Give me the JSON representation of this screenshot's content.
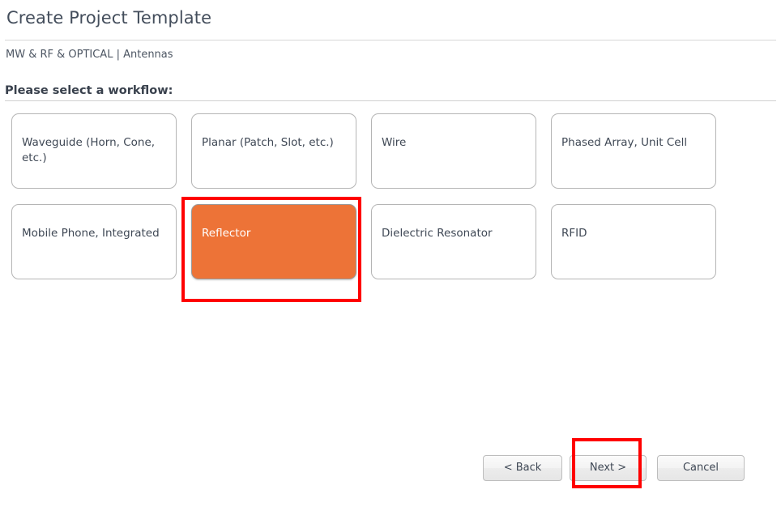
{
  "header": {
    "title": "Create Project Template",
    "breadcrumb": "MW & RF & OPTICAL  |  Antennas",
    "section_label": "Please select a workflow:"
  },
  "workflows": {
    "selected": "Reflector",
    "selected_color": "#ed7337",
    "highlight_color": "#ff0000",
    "items": [
      {
        "label": "Waveguide (Horn, Cone, etc.)",
        "selected": false
      },
      {
        "label": "Planar (Patch, Slot, etc.)",
        "selected": false
      },
      {
        "label": "Wire",
        "selected": false
      },
      {
        "label": "Phased Array, Unit Cell",
        "selected": false
      },
      {
        "label": "Mobile Phone, Integrated",
        "selected": false
      },
      {
        "label": "Reflector",
        "selected": true
      },
      {
        "label": "Dielectric Resonator",
        "selected": false
      },
      {
        "label": "RFID",
        "selected": false
      }
    ]
  },
  "footer": {
    "back_label": "< Back",
    "next_label": "Next >",
    "cancel_label": "Cancel"
  }
}
